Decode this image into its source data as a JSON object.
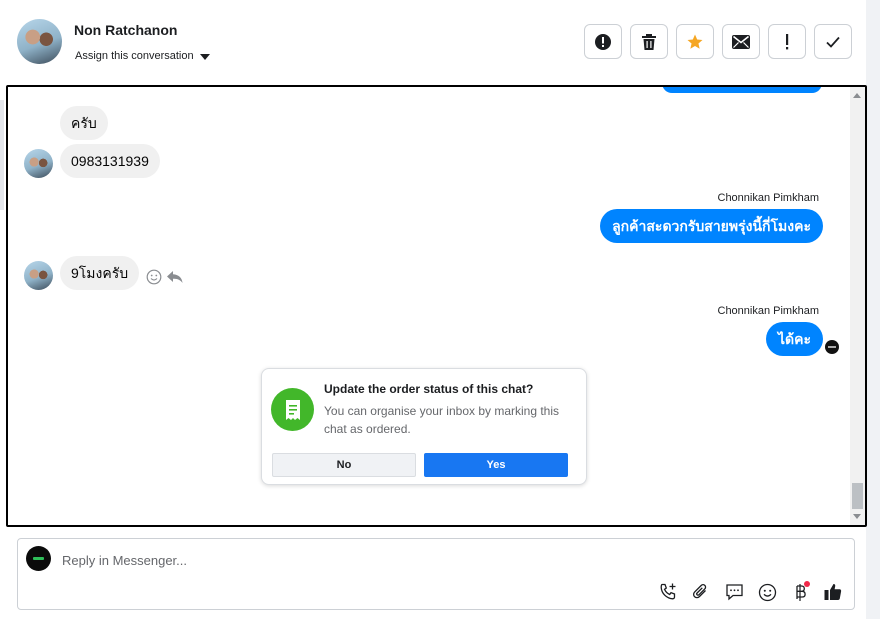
{
  "header": {
    "contact_name": "Non Ratchanon",
    "assign_label": "Assign this conversation",
    "toolbar": [
      {
        "name": "mark-spam-button",
        "icon": "alert-circle-icon"
      },
      {
        "name": "delete-button",
        "icon": "trash-icon"
      },
      {
        "name": "star-button",
        "icon": "star-icon"
      },
      {
        "name": "mark-unread-button",
        "icon": "envelope-icon"
      },
      {
        "name": "follow-up-button",
        "icon": "exclamation-icon"
      },
      {
        "name": "mark-done-button",
        "icon": "checkmark-icon"
      }
    ]
  },
  "messages": {
    "m1": {
      "text": "ครับ"
    },
    "m2": {
      "text": "0983131939"
    },
    "m3": {
      "sender": "Chonnikan Pimkham",
      "text": "ลูกค้าสะดวกรับสายพรุ่งนี้กี่โมงคะ"
    },
    "m4": {
      "text": "9โมงครับ"
    },
    "m5": {
      "sender": "Chonnikan Pimkham",
      "text": "ได้คะ"
    }
  },
  "order_prompt": {
    "title": "Update the order status of this chat?",
    "description": "You can organise your inbox by marking this chat as ordered.",
    "no_label": "No",
    "yes_label": "Yes"
  },
  "composer": {
    "placeholder": "Reply in Messenger..."
  },
  "colors": {
    "accent": "#1877f2",
    "outgoing_bubble": "#0084ff",
    "order_icon": "#42b72a",
    "star": "#f5a623"
  }
}
